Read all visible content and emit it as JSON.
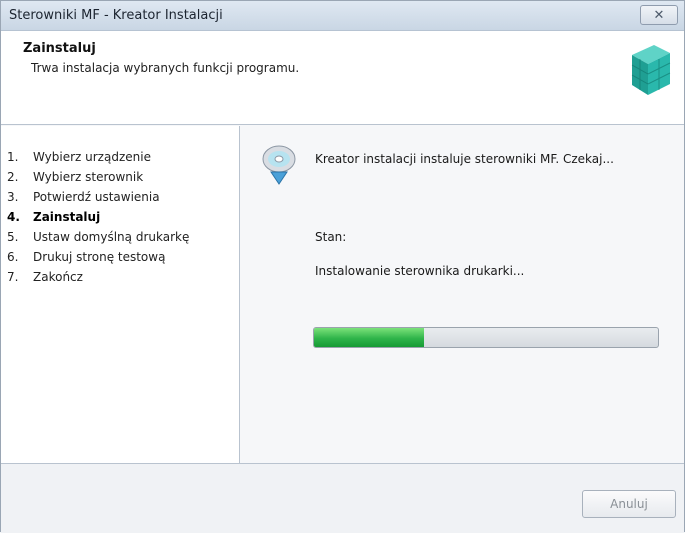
{
  "window": {
    "title": "Sterowniki MF - Kreator Instalacji",
    "close_glyph": "✕"
  },
  "header": {
    "title": "Zainstaluj",
    "subtitle": "Trwa instalacja wybranych funkcji programu.",
    "icon": "installer-boxes-icon"
  },
  "steps": [
    {
      "num": "1.",
      "label": "Wybierz urządzenie",
      "active": false
    },
    {
      "num": "2.",
      "label": "Wybierz sterownik",
      "active": false
    },
    {
      "num": "3.",
      "label": "Potwierdź ustawienia",
      "active": false
    },
    {
      "num": "4.",
      "label": "Zainstaluj",
      "active": true
    },
    {
      "num": "5.",
      "label": "Ustaw domyślną drukarkę",
      "active": false
    },
    {
      "num": "6.",
      "label": "Drukuj stronę testową",
      "active": false
    },
    {
      "num": "7.",
      "label": "Zakończ",
      "active": false
    }
  ],
  "main": {
    "message": "Kreator instalacji instaluje sterowniki MF. Czekaj...",
    "status_label": "Stan:",
    "status_value": "Instalowanie sterownika drukarki...",
    "progress_fraction": 0.32,
    "icon": "cd-install-icon"
  },
  "footer": {
    "cancel_label": "Anuluj"
  },
  "colors": {
    "progress_green": "#2fb44a",
    "header_bg": "#ffffff",
    "titlebar": "#c9d6e4"
  }
}
